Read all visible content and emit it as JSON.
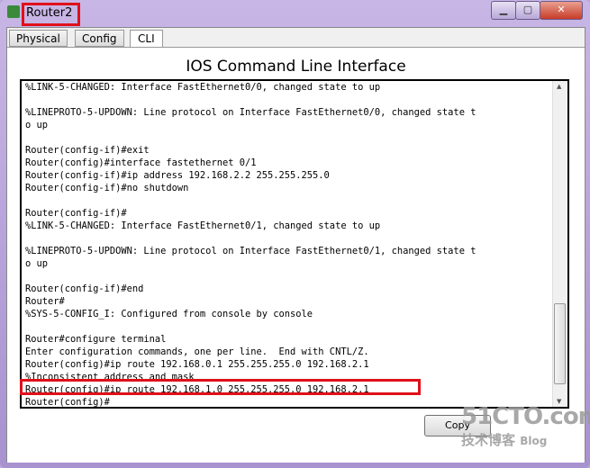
{
  "window": {
    "title": "Router2",
    "controls": [
      "minimize",
      "maximize",
      "close"
    ]
  },
  "tabs": [
    {
      "label": "Physical"
    },
    {
      "label": "Config"
    },
    {
      "label": "CLI",
      "active": true
    }
  ],
  "heading": "IOS Command Line Interface",
  "terminal": {
    "lines": [
      "%LINK-5-CHANGED: Interface FastEthernet0/0, changed state to up",
      "",
      "%LINEPROTO-5-UPDOWN: Line protocol on Interface FastEthernet0/0, changed state t",
      "o up",
      "",
      "Router(config-if)#exit",
      "Router(config)#interface fastethernet 0/1",
      "Router(config-if)#ip address 192.168.2.2 255.255.255.0",
      "Router(config-if)#no shutdown",
      "",
      "Router(config-if)#",
      "%LINK-5-CHANGED: Interface FastEthernet0/1, changed state to up",
      "",
      "%LINEPROTO-5-UPDOWN: Line protocol on Interface FastEthernet0/1, changed state t",
      "o up",
      "",
      "Router(config-if)#end",
      "Router#",
      "%SYS-5-CONFIG_I: Configured from console by console",
      "",
      "Router#configure terminal",
      "Enter configuration commands, one per line.  End with CNTL/Z.",
      "Router(config)#ip route 192.168.0.1 255.255.255.0 192.168.2.1",
      "%Inconsistent address and mask",
      "Router(config)#ip route 192.168.1.0 255.255.255.0 192.168.2.1",
      "Router(config)#"
    ]
  },
  "buttons": {
    "copy": "Copy"
  },
  "watermark": {
    "brand": "51CTO.com",
    "sub": "技术博客",
    "blog": "Blog"
  },
  "colors": {
    "highlight": "#e0101a"
  }
}
